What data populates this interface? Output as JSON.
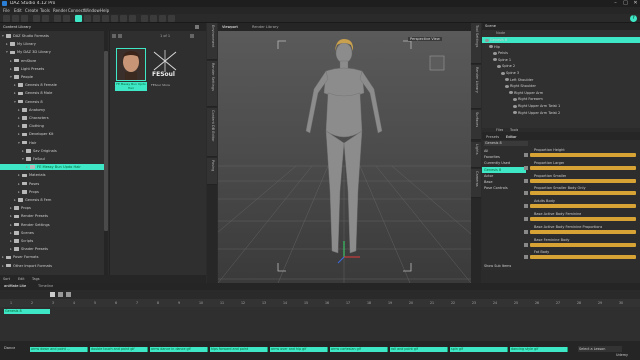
{
  "window": {
    "title": "DAZ Studio 4.12 Pro",
    "controls": [
      "–",
      "□",
      "✕"
    ]
  },
  "menu": [
    "File",
    "Edit",
    "Create",
    "Tools",
    "Render",
    "Connect",
    "Window",
    "Help"
  ],
  "toolbar": {
    "help_label": "?"
  },
  "left_panel": {
    "tabs": [
      "Content Library",
      "Smart Content",
      "Shaping"
    ],
    "tree": [
      {
        "label": "DAZ Studio Formats",
        "indent": 0,
        "arrow": "▾"
      },
      {
        "label": "My Library",
        "indent": 1,
        "arrow": "▸"
      },
      {
        "label": "My DAZ 3D Library",
        "indent": 1,
        "arrow": "▾"
      },
      {
        "label": "emStore",
        "indent": 2,
        "arrow": "▸"
      },
      {
        "label": "Light Presets",
        "indent": 2,
        "arrow": "▸"
      },
      {
        "label": "People",
        "indent": 2,
        "arrow": "▾"
      },
      {
        "label": "Genesis 8 Female",
        "indent": 3,
        "arrow": "▸"
      },
      {
        "label": "Genesis 8 Male",
        "indent": 3,
        "arrow": "▸"
      },
      {
        "label": "Genesis 8",
        "indent": 3,
        "arrow": "▾"
      },
      {
        "label": "Anatomy",
        "indent": 4,
        "arrow": "▸"
      },
      {
        "label": "Characters",
        "indent": 4,
        "arrow": "▸"
      },
      {
        "label": "Clothing",
        "indent": 4,
        "arrow": "▸"
      },
      {
        "label": "Developer Kit",
        "indent": 4,
        "arrow": "▸"
      },
      {
        "label": "Hair",
        "indent": 4,
        "arrow": "▾"
      },
      {
        "label": "Sav Originals",
        "indent": 5,
        "arrow": "▸"
      },
      {
        "label": "FeSoul",
        "indent": 5,
        "arrow": "▾"
      },
      {
        "label": "FE Messy Bun Updo Hair",
        "indent": 6,
        "arrow": "▸",
        "selected": true
      },
      {
        "label": "Materials",
        "indent": 4,
        "arrow": "▸"
      },
      {
        "label": "Poses",
        "indent": 4,
        "arrow": "▸"
      },
      {
        "label": "Props",
        "indent": 4,
        "arrow": "▸"
      },
      {
        "label": "Genesis 8 Fem",
        "indent": 3,
        "arrow": "▸"
      },
      {
        "label": "Props",
        "indent": 2,
        "arrow": "▸"
      },
      {
        "label": "Render Presets",
        "indent": 2,
        "arrow": "▸"
      },
      {
        "label": "Render Settings",
        "indent": 2,
        "arrow": "▸"
      },
      {
        "label": "Scenes",
        "indent": 2,
        "arrow": "▸"
      },
      {
        "label": "Scripts",
        "indent": 2,
        "arrow": "▸"
      },
      {
        "label": "Shader Presets",
        "indent": 2,
        "arrow": "▸"
      },
      {
        "label": "Poser Formats",
        "indent": 0,
        "arrow": "▸"
      },
      {
        "label": "Other Import Formats",
        "indent": 0,
        "arrow": "▸"
      }
    ],
    "pagination": "1 of 1",
    "thumbnails": [
      {
        "caption": "FE Messy Bun Updo Hair",
        "selected": true
      },
      {
        "caption": "FESoul Store",
        "logo_text": "FESoul",
        "selected": false
      }
    ],
    "bottom_tabs": [
      "Sort",
      "Edit",
      "Tags"
    ]
  },
  "left_vtabs": [
    "Environment",
    "Render Settings",
    "Content DB Editor",
    "Posing"
  ],
  "mid_vtabs": [
    "Tool Settings",
    "Render Library",
    "Surfaces",
    "Lights",
    "Cameras"
  ],
  "viewport": {
    "tabs": [
      "Viewport",
      "Render Library"
    ],
    "view_label": "Perspective View"
  },
  "right_panel": {
    "tabs": [
      "Scene",
      "Posing"
    ],
    "scene_header": "Node",
    "scene_rows": [
      {
        "label": "Genesis 8",
        "indent": 0,
        "selected": true
      },
      {
        "label": "Hip",
        "indent": 1
      },
      {
        "label": "Pelvis",
        "indent": 2
      },
      {
        "label": "Spine 1",
        "indent": 2
      },
      {
        "label": "Spine 2",
        "indent": 3
      },
      {
        "label": "Spine 3",
        "indent": 4
      },
      {
        "label": "Left Shoulder",
        "indent": 5
      },
      {
        "label": "Right Shoulder",
        "indent": 5
      },
      {
        "label": "Right Upper Arm",
        "indent": 6
      },
      {
        "label": "Right Forearm",
        "indent": 7
      },
      {
        "label": "Right Upper Arm Twist 1",
        "indent": 7
      },
      {
        "label": "Right Upper Arm Twist 2",
        "indent": 7
      }
    ],
    "scene_bottom_tabs": [
      "Files",
      "Tools"
    ],
    "param_tabs": [
      "Presets",
      "Editor"
    ],
    "param_header": "Genesis 8",
    "param_list": [
      {
        "label": "All"
      },
      {
        "label": "Favorites"
      },
      {
        "label": "Currently Used"
      },
      {
        "label": "Genesis 8",
        "selected": true
      },
      {
        "label": "Actor"
      },
      {
        "label": "Base"
      },
      {
        "label": "Pose Controls"
      }
    ],
    "sliders": [
      "Proportion Height",
      "Proportion Larger",
      "Proportion Smaller",
      "Proportion Smaller Body Only",
      "Adults Body",
      "Base Active Body Feminine",
      "Base Active Body Feminine Proportions",
      "Base Feminine Body",
      "Fat Body"
    ],
    "show_sub_items": "Show Sub Items"
  },
  "timeline": {
    "tabs": [
      "aniMate Lite",
      "Timeline"
    ],
    "ruler": [
      "1",
      "2",
      "3",
      "4",
      "5",
      "6",
      "7",
      "8",
      "9",
      "10",
      "11",
      "12",
      "13",
      "14",
      "15",
      "16",
      "17",
      "18",
      "19",
      "20",
      "21",
      "22",
      "23",
      "24",
      "25",
      "26",
      "27",
      "28",
      "29",
      "30"
    ],
    "track_label": "Genesis 8",
    "status_left": "Dance",
    "clips": [
      "arms down and point ...",
      "double touch and point gif",
      "arms dance in dance gif",
      "hips forward and point",
      "arms over and hip gif",
      "arms cartesian gif",
      "roll and point gif",
      "spin gif",
      "dancing style gif"
    ],
    "status_right": "Select a Lesson",
    "watermark": "Udemy"
  },
  "colors": {
    "accent": "#3ee8c6",
    "slider": "#d7a335",
    "panel": "#303030"
  }
}
